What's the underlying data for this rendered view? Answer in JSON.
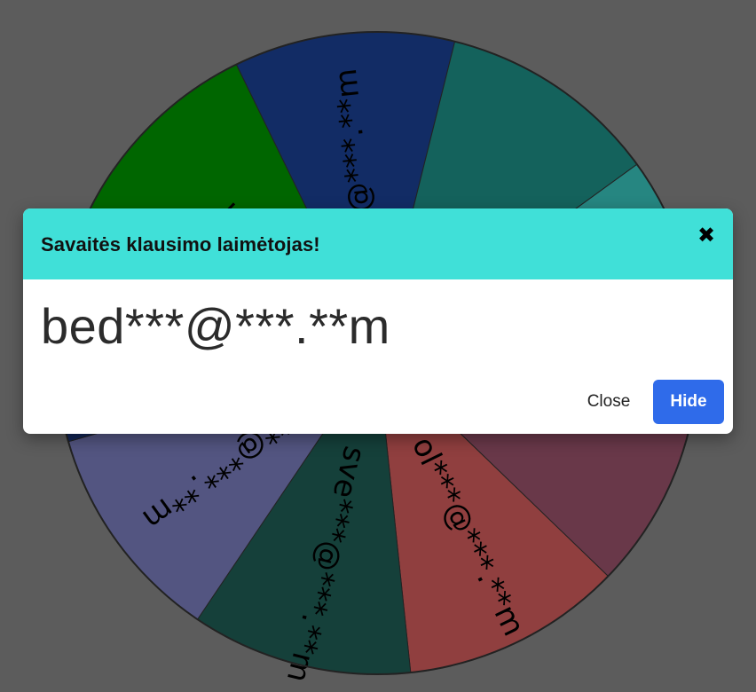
{
  "wheel": {
    "segments": [
      {
        "label": "***@***.**m",
        "color": "#1e4aa8"
      },
      {
        "label": "",
        "color": "#22a39a"
      },
      {
        "label": "",
        "color": "#40e0d8"
      },
      {
        "label": "",
        "color": "#b05e7a"
      },
      {
        "label": "ol***@***.**m",
        "color": "#f06a6a"
      },
      {
        "label": "sve***@***.**m",
        "color": "#236b62"
      },
      {
        "label": "***@***.**m",
        "color": "#8a8ed8"
      },
      {
        "label": "",
        "color": "#1f3f8f"
      },
      {
        "label": "***.**m",
        "color": "#00aa00"
      }
    ]
  },
  "modal": {
    "title": "Savaitės klausimo laimėtojas!",
    "close_icon": "close-icon",
    "winner": "bed***@***.**m",
    "close_label": "Close",
    "hide_label": "Hide"
  },
  "colors": {
    "overlay": "#999999",
    "header": "#40e0d8",
    "primary_button": "#2f6bea"
  }
}
